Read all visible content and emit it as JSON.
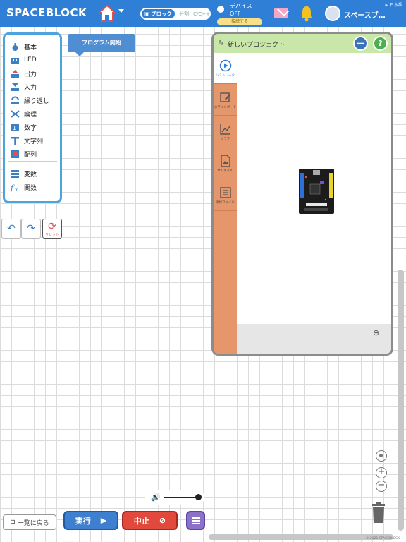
{
  "header": {
    "logo": "SPACEBLOCK",
    "mode_active": "ブロック",
    "mode_split": "分割",
    "mode_code": "C/C++",
    "device_label": "デバイス",
    "device_state": "OFF",
    "device_connect": "接続する",
    "user_name": "スペースブ…",
    "language": "日本語"
  },
  "palette": {
    "categories": [
      {
        "label": "基本",
        "color": "#3b7fc4"
      },
      {
        "label": "LED",
        "color": "#3b7fc4"
      },
      {
        "label": "出力",
        "color": "#e05050"
      },
      {
        "label": "入力",
        "color": "#3b7fc4"
      },
      {
        "label": "繰り返し",
        "color": "#3b7fc4"
      },
      {
        "label": "論理",
        "color": "#3b7fc4"
      },
      {
        "label": "数字",
        "color": "#3b7fc4"
      },
      {
        "label": "文字列",
        "color": "#3b7fc4"
      },
      {
        "label": "配列",
        "color": "#e05050"
      }
    ],
    "variables_label": "変数",
    "functions_label": "関数"
  },
  "edit": {
    "reset_label": "リセット"
  },
  "workspace": {
    "start_block_label": "プログラム開始"
  },
  "project": {
    "title": "新しいプロジェクト",
    "tabs": [
      {
        "label": "シミュレータ",
        "icon": "play-circle"
      },
      {
        "label": "ホワイトボード",
        "icon": "pencil-square"
      },
      {
        "label": "グラフ",
        "icon": "line-chart"
      },
      {
        "label": "サムネイル",
        "icon": "image"
      },
      {
        "label": "添付ファイル",
        "icon": "list-file"
      }
    ]
  },
  "bottom": {
    "back_label": "一覧に戻る",
    "run_label": "実行",
    "stop_label": "中止",
    "volume_level": 0.9
  },
  "footer": {
    "copyright": "© 2021 SPACEBLOCK"
  },
  "colors": {
    "header_blue": "#2f7fd6",
    "palette_border": "#4fa3dc",
    "project_header": "#c9e7a8",
    "side_tabs": "#e6966b",
    "run": "#3f7fcf",
    "stop": "#e0493c",
    "menu": "#8b72c8"
  }
}
